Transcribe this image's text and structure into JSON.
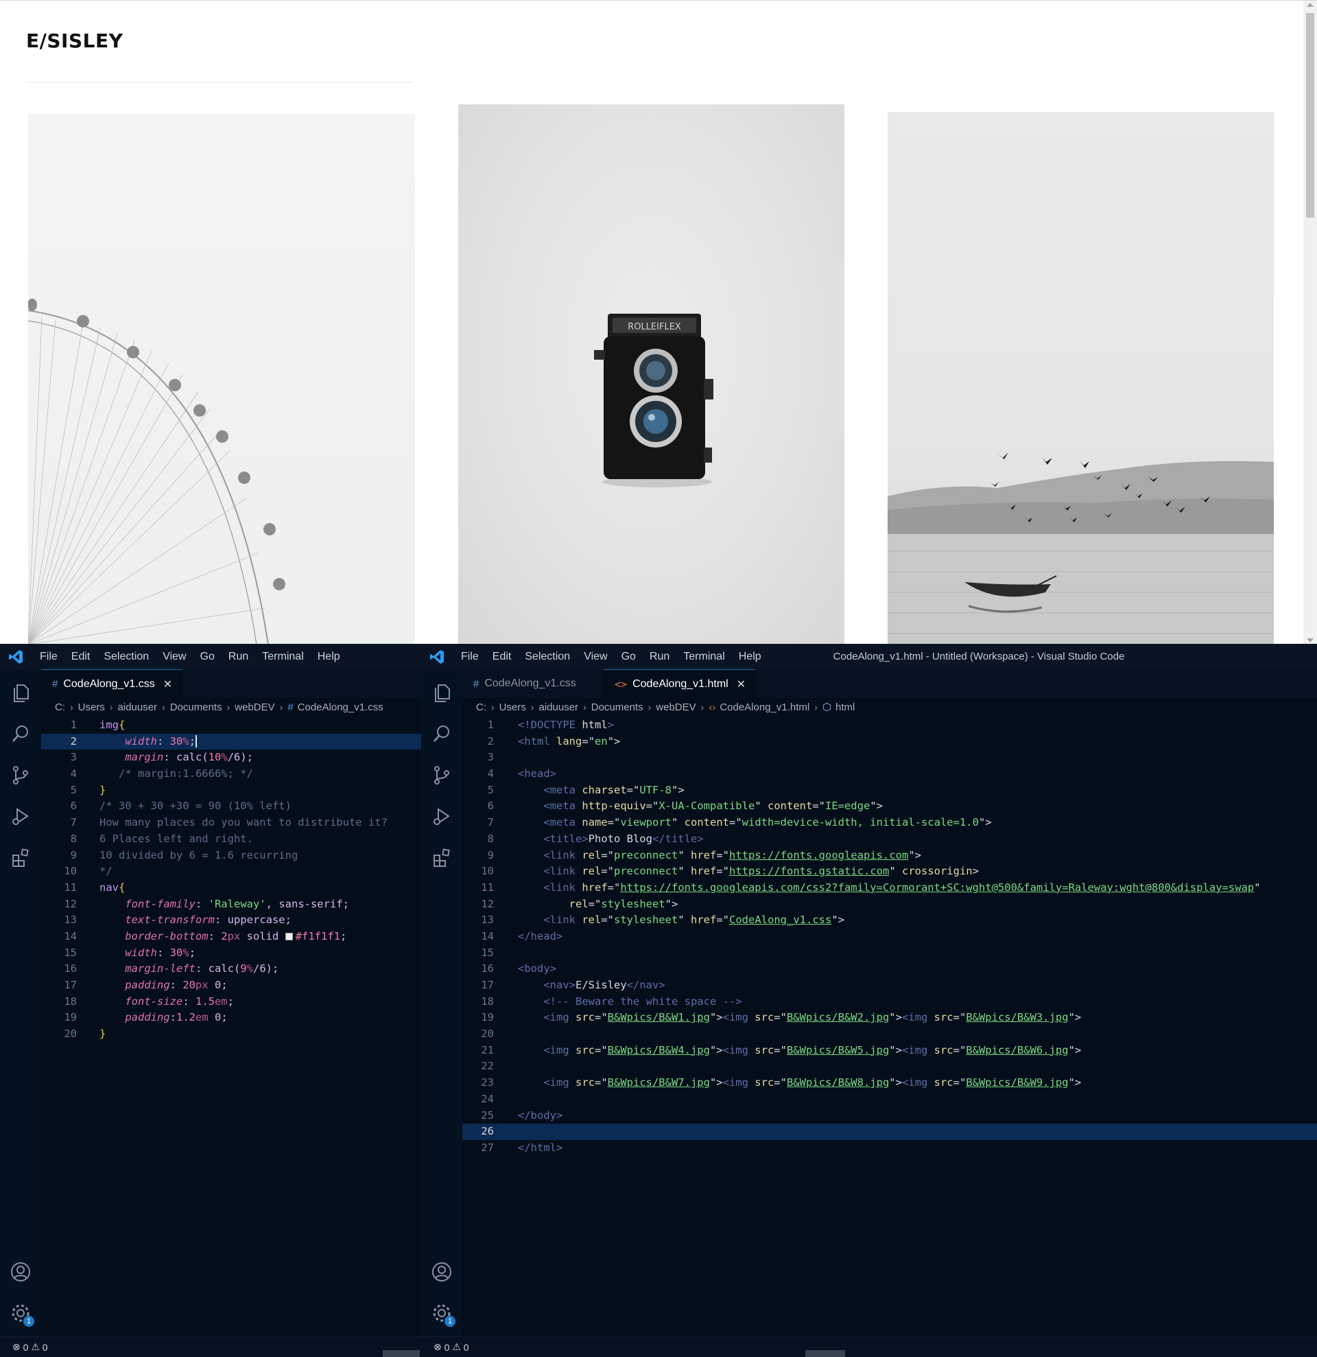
{
  "browser": {
    "site_title": "E/SISLEY",
    "photos": [
      "ferris-wheel",
      "rolleiflex-camera",
      "boat-and-birds"
    ],
    "camera_brand": "ROLLEIFLEX"
  },
  "vscode_left": {
    "menu": [
      "File",
      "Edit",
      "Selection",
      "View",
      "Go",
      "Run",
      "Terminal",
      "Help"
    ],
    "tab": {
      "label": "CodeAlong_v1.css",
      "icon": "#",
      "close": "✕"
    },
    "breadcrumb": [
      "C:",
      "Users",
      "aiduuser",
      "Documents",
      "webDEV",
      "CodeAlong_v1.css"
    ],
    "badge": "1",
    "status": {
      "errors": "0",
      "warnings": "0"
    }
  },
  "vscode_right": {
    "title": "CodeAlong_v1.html - Untitled (Workspace) - Visual Studio Code",
    "menu": [
      "File",
      "Edit",
      "Selection",
      "View",
      "Go",
      "Run",
      "Terminal",
      "Help"
    ],
    "tabs": [
      {
        "label": "CodeAlong_v1.css",
        "icon": "#"
      },
      {
        "label": "CodeAlong_v1.html",
        "icon": "<>",
        "close": "✕"
      }
    ],
    "breadcrumb": [
      "C:",
      "Users",
      "aiduuser",
      "Documents",
      "webDEV",
      "CodeAlong_v1.html",
      "html"
    ],
    "badge": "1",
    "status": {
      "errors": "0",
      "warnings": "0"
    }
  },
  "css_lines": [
    [
      [
        "img",
        "sel"
      ],
      [
        "{",
        "brace"
      ]
    ],
    [
      [
        "    ",
        ""
      ],
      [
        "width",
        "prop"
      ],
      [
        ": ",
        ""
      ],
      [
        "30",
        "num"
      ],
      [
        "%",
        "unit"
      ],
      [
        ";",
        ""
      ]
    ],
    [
      [
        "    ",
        ""
      ],
      [
        "margin",
        "prop"
      ],
      [
        ": ",
        ""
      ],
      [
        "calc(",
        "val"
      ],
      [
        "10",
        "num"
      ],
      [
        "%",
        "unit"
      ],
      [
        "/6);",
        "val"
      ]
    ],
    [
      [
        "   /* margin:1.6666%; */",
        "com"
      ]
    ],
    [
      [
        "}",
        "brace"
      ]
    ],
    [
      [
        "/* 30 + 30 +30 = 90 (10% left)",
        "com"
      ]
    ],
    [
      [
        "How many places do you want to distribute it?",
        "com"
      ]
    ],
    [
      [
        "6 Places left and right.",
        "com"
      ]
    ],
    [
      [
        "10 divided by 6 = 1.6 recurring",
        "com"
      ]
    ],
    [
      [
        "*/",
        "com"
      ]
    ],
    [
      [
        "nav",
        "sel"
      ],
      [
        "{",
        "brace"
      ]
    ],
    [
      [
        "    ",
        ""
      ],
      [
        "font-family",
        "prop"
      ],
      [
        ": ",
        ""
      ],
      [
        "'Raleway'",
        "str"
      ],
      [
        ", sans-serif;",
        "val"
      ]
    ],
    [
      [
        "    ",
        ""
      ],
      [
        "text-transform",
        "prop"
      ],
      [
        ": ",
        ""
      ],
      [
        "uppercase;",
        "val"
      ]
    ],
    [
      [
        "    ",
        ""
      ],
      [
        "border-bottom",
        "prop"
      ],
      [
        ": ",
        ""
      ],
      [
        "2",
        "num"
      ],
      [
        "px",
        "unit"
      ],
      [
        " solid ",
        "val"
      ],
      [
        "SWATCH",
        "swatch"
      ],
      [
        "#f1f1f1",
        "num"
      ],
      [
        ";",
        ""
      ]
    ],
    [
      [
        "    ",
        ""
      ],
      [
        "width",
        "prop"
      ],
      [
        ": ",
        ""
      ],
      [
        "30",
        "num"
      ],
      [
        "%",
        "unit"
      ],
      [
        ";",
        ""
      ]
    ],
    [
      [
        "    ",
        ""
      ],
      [
        "margin-left",
        "prop"
      ],
      [
        ": ",
        ""
      ],
      [
        "calc(",
        "val"
      ],
      [
        "9",
        "num"
      ],
      [
        "%",
        "unit"
      ],
      [
        "/6);",
        "val"
      ]
    ],
    [
      [
        "    ",
        ""
      ],
      [
        "padding",
        "prop"
      ],
      [
        ": ",
        ""
      ],
      [
        "20",
        "num"
      ],
      [
        "px",
        "unit"
      ],
      [
        " 0;",
        "val"
      ]
    ],
    [
      [
        "    ",
        ""
      ],
      [
        "font-size",
        "prop"
      ],
      [
        ": ",
        ""
      ],
      [
        "1.5",
        "num"
      ],
      [
        "em",
        "unit"
      ],
      [
        ";",
        ""
      ]
    ],
    [
      [
        "    ",
        ""
      ],
      [
        "padding",
        "prop"
      ],
      [
        ":",
        ""
      ],
      [
        "1.2",
        "num"
      ],
      [
        "em",
        "unit"
      ],
      [
        " 0;",
        "val"
      ]
    ],
    [
      [
        "}",
        "brace"
      ]
    ]
  ],
  "html_lines": [
    [
      [
        "<!",
        "tagp"
      ],
      [
        "DOCTYPE",
        "tag"
      ],
      [
        " html",
        "txt"
      ],
      [
        ">",
        "tagp"
      ]
    ],
    [
      [
        "<html",
        "tagp"
      ],
      [
        " lang",
        "attr"
      ],
      [
        "=\"",
        "txt"
      ],
      [
        "en",
        "hstr"
      ],
      [
        "\">",
        "txt"
      ]
    ],
    [],
    [
      [
        "<head>",
        "tagp"
      ]
    ],
    [
      [
        "    ",
        ""
      ],
      [
        "<meta",
        "tagp"
      ],
      [
        " charset",
        "attr"
      ],
      [
        "=\"",
        "txt"
      ],
      [
        "UTF-8",
        "hstr"
      ],
      [
        "\">",
        "txt"
      ]
    ],
    [
      [
        "    ",
        ""
      ],
      [
        "<meta",
        "tagp"
      ],
      [
        " http-equiv",
        "attr"
      ],
      [
        "=\"",
        "txt"
      ],
      [
        "X-UA-Compatible",
        "hstr"
      ],
      [
        "\"",
        "txt"
      ],
      [
        " content",
        "attr"
      ],
      [
        "=\"",
        "txt"
      ],
      [
        "IE=edge",
        "hstr"
      ],
      [
        "\">",
        "txt"
      ]
    ],
    [
      [
        "    ",
        ""
      ],
      [
        "<meta",
        "tagp"
      ],
      [
        " name",
        "attr"
      ],
      [
        "=\"",
        "txt"
      ],
      [
        "viewport",
        "hstr"
      ],
      [
        "\"",
        "txt"
      ],
      [
        " content",
        "attr"
      ],
      [
        "=\"",
        "txt"
      ],
      [
        "width=device-width, initial-scale=1.0",
        "hstr"
      ],
      [
        "\">",
        "txt"
      ]
    ],
    [
      [
        "    ",
        ""
      ],
      [
        "<title>",
        "tagp"
      ],
      [
        "Photo Blog",
        "txt"
      ],
      [
        "</title>",
        "tagp"
      ]
    ],
    [
      [
        "    ",
        ""
      ],
      [
        "<link",
        "tagp"
      ],
      [
        " rel",
        "attr"
      ],
      [
        "=\"",
        "txt"
      ],
      [
        "preconnect",
        "hstr"
      ],
      [
        "\"",
        "txt"
      ],
      [
        " href",
        "attr"
      ],
      [
        "=\"",
        "txt"
      ],
      [
        "https://fonts.googleapis.com",
        "url"
      ],
      [
        "\">",
        "txt"
      ]
    ],
    [
      [
        "    ",
        ""
      ],
      [
        "<link",
        "tagp"
      ],
      [
        " rel",
        "attr"
      ],
      [
        "=\"",
        "txt"
      ],
      [
        "preconnect",
        "hstr"
      ],
      [
        "\"",
        "txt"
      ],
      [
        " href",
        "attr"
      ],
      [
        "=\"",
        "txt"
      ],
      [
        "https://fonts.gstatic.com",
        "url"
      ],
      [
        "\"",
        "txt"
      ],
      [
        " crossorigin",
        "attr"
      ],
      [
        ">",
        "txt"
      ]
    ],
    [
      [
        "    ",
        ""
      ],
      [
        "<link",
        "tagp"
      ],
      [
        " href",
        "attr"
      ],
      [
        "=\"",
        "txt"
      ],
      [
        "https://fonts.googleapis.com/css2?family=Cormorant+SC:wght@500&family=Raleway:wght@800&display=swap",
        "url"
      ],
      [
        "\"",
        "txt"
      ]
    ],
    [
      [
        "        ",
        ""
      ],
      [
        "rel",
        "attr"
      ],
      [
        "=\"",
        "txt"
      ],
      [
        "stylesheet",
        "hstr"
      ],
      [
        "\">",
        "txt"
      ]
    ],
    [
      [
        "    ",
        ""
      ],
      [
        "<link",
        "tagp"
      ],
      [
        " rel",
        "attr"
      ],
      [
        "=\"",
        "txt"
      ],
      [
        "stylesheet",
        "hstr"
      ],
      [
        "\"",
        "txt"
      ],
      [
        " href",
        "attr"
      ],
      [
        "=\"",
        "txt"
      ],
      [
        "CodeAlong_v1.css",
        "url"
      ],
      [
        "\">",
        "txt"
      ]
    ],
    [
      [
        "</head>",
        "tagp"
      ]
    ],
    [],
    [
      [
        "<body>",
        "tagp"
      ]
    ],
    [
      [
        "    ",
        ""
      ],
      [
        "<nav>",
        "tagp"
      ],
      [
        "E/Sisley",
        "txt"
      ],
      [
        "</nav>",
        "tagp"
      ]
    ],
    [
      [
        "    ",
        ""
      ],
      [
        "<!-- Beware the white space -->",
        "tagp"
      ]
    ],
    [
      [
        "    ",
        ""
      ],
      [
        "<img",
        "tagp"
      ],
      [
        " src",
        "attr"
      ],
      [
        "=\"",
        "txt"
      ],
      [
        "B&Wpics/B&W1.jpg",
        "url"
      ],
      [
        "\">",
        "txt"
      ],
      [
        "<img",
        "tagp"
      ],
      [
        " src",
        "attr"
      ],
      [
        "=\"",
        "txt"
      ],
      [
        "B&Wpics/B&W2.jpg",
        "url"
      ],
      [
        "\">",
        "txt"
      ],
      [
        "<img",
        "tagp"
      ],
      [
        " src",
        "attr"
      ],
      [
        "=\"",
        "txt"
      ],
      [
        "B&Wpics/B&W3.jpg",
        "url"
      ],
      [
        "\">",
        "txt"
      ]
    ],
    [],
    [
      [
        "    ",
        ""
      ],
      [
        "<img",
        "tagp"
      ],
      [
        " src",
        "attr"
      ],
      [
        "=\"",
        "txt"
      ],
      [
        "B&Wpics/B&W4.jpg",
        "url"
      ],
      [
        "\">",
        "txt"
      ],
      [
        "<img",
        "tagp"
      ],
      [
        " src",
        "attr"
      ],
      [
        "=\"",
        "txt"
      ],
      [
        "B&Wpics/B&W5.jpg",
        "url"
      ],
      [
        "\">",
        "txt"
      ],
      [
        "<img",
        "tagp"
      ],
      [
        " src",
        "attr"
      ],
      [
        "=\"",
        "txt"
      ],
      [
        "B&Wpics/B&W6.jpg",
        "url"
      ],
      [
        "\">",
        "txt"
      ]
    ],
    [],
    [
      [
        "    ",
        ""
      ],
      [
        "<img",
        "tagp"
      ],
      [
        " src",
        "attr"
      ],
      [
        "=\"",
        "txt"
      ],
      [
        "B&Wpics/B&W7.jpg",
        "url"
      ],
      [
        "\">",
        "txt"
      ],
      [
        "<img",
        "tagp"
      ],
      [
        " src",
        "attr"
      ],
      [
        "=\"",
        "txt"
      ],
      [
        "B&Wpics/B&W8.jpg",
        "url"
      ],
      [
        "\">",
        "txt"
      ],
      [
        "<img",
        "tagp"
      ],
      [
        " src",
        "attr"
      ],
      [
        "=\"",
        "txt"
      ],
      [
        "B&Wpics/B&W9.jpg",
        "url"
      ],
      [
        "\">",
        "txt"
      ]
    ],
    [],
    [
      [
        "</body>",
        "tagp"
      ]
    ],
    [],
    [
      [
        "</html>",
        "tagp"
      ]
    ]
  ],
  "css_current_line": 2,
  "html_current_line": 26
}
